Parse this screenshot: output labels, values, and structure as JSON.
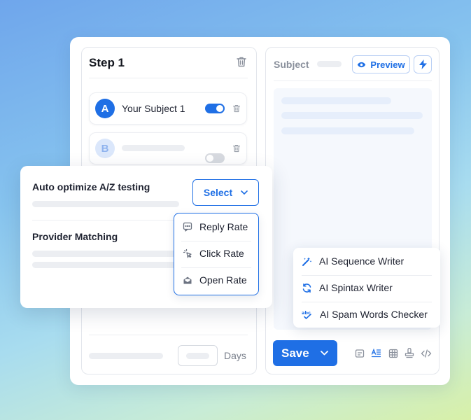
{
  "step_panel": {
    "title": "Step 1",
    "variants": [
      {
        "badge": "A",
        "label": "Your Subject 1",
        "enabled": true
      },
      {
        "badge": "B",
        "label": "",
        "enabled": false
      }
    ],
    "footer_unit": "Days"
  },
  "editor": {
    "subject_label": "Subject",
    "preview_label": "Preview",
    "save_label": "Save"
  },
  "optimize_card": {
    "title": "Auto optimize A/Z testing",
    "select_label": "Select",
    "provider_title": "Provider Matching",
    "options": [
      {
        "icon": "reply-rate-icon",
        "label": "Reply Rate"
      },
      {
        "icon": "click-rate-icon",
        "label": "Click Rate"
      },
      {
        "icon": "open-rate-icon",
        "label": "Open Rate"
      }
    ]
  },
  "ai_menu": {
    "items": [
      {
        "icon": "magic-wand-icon",
        "label": "AI Sequence Writer"
      },
      {
        "icon": "refresh-icon",
        "label": "AI Spintax Writer"
      },
      {
        "icon": "spell-check-icon",
        "label": "AI Spam Words Checker"
      }
    ]
  },
  "colors": {
    "primary": "#1f6fe5",
    "variant_b": "#a9c6f3",
    "skeleton": "#eceef2"
  }
}
